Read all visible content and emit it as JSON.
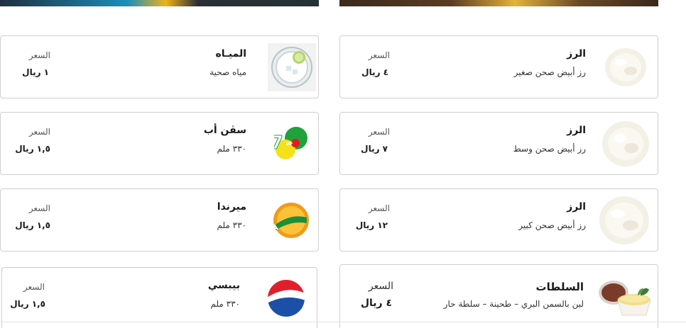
{
  "price_label": "السعر",
  "cards": [
    {
      "name": "الميـاه",
      "desc": "مياه صحية",
      "price": "١ ريال",
      "icon": "water-glass-icon"
    },
    {
      "name": "سڤن أب",
      "desc": "٣٣٠ ملم",
      "price": "١,٥ ريال",
      "icon": "7up-logo-icon"
    },
    {
      "name": "ميرندا",
      "desc": "٣٣٠ ملم",
      "price": "١,٥ ريال",
      "icon": "mirinda-logo-icon"
    },
    {
      "name": "بيبسي",
      "desc": "٣٣٠ ملم",
      "price": "١,٥ ريال",
      "icon": "pepsi-logo-icon"
    },
    {
      "name": "الرز",
      "desc": "رز أبيض صحن صغير",
      "price": "٤ ريال",
      "icon": "rice-icon"
    },
    {
      "name": "الرز",
      "desc": "رز أبيض صحن وسط",
      "price": "٧ ريال",
      "icon": "rice-icon"
    },
    {
      "name": "الرز",
      "desc": "رز أبيض صحن كبير",
      "price": "١٢ ريال",
      "icon": "rice-icon"
    },
    {
      "name": "السلطات",
      "desc": "لبن بالسمن البري – طحينة – سلطة حار",
      "price": "٤ ريال",
      "icon": "salad-bowls-icon"
    }
  ]
}
